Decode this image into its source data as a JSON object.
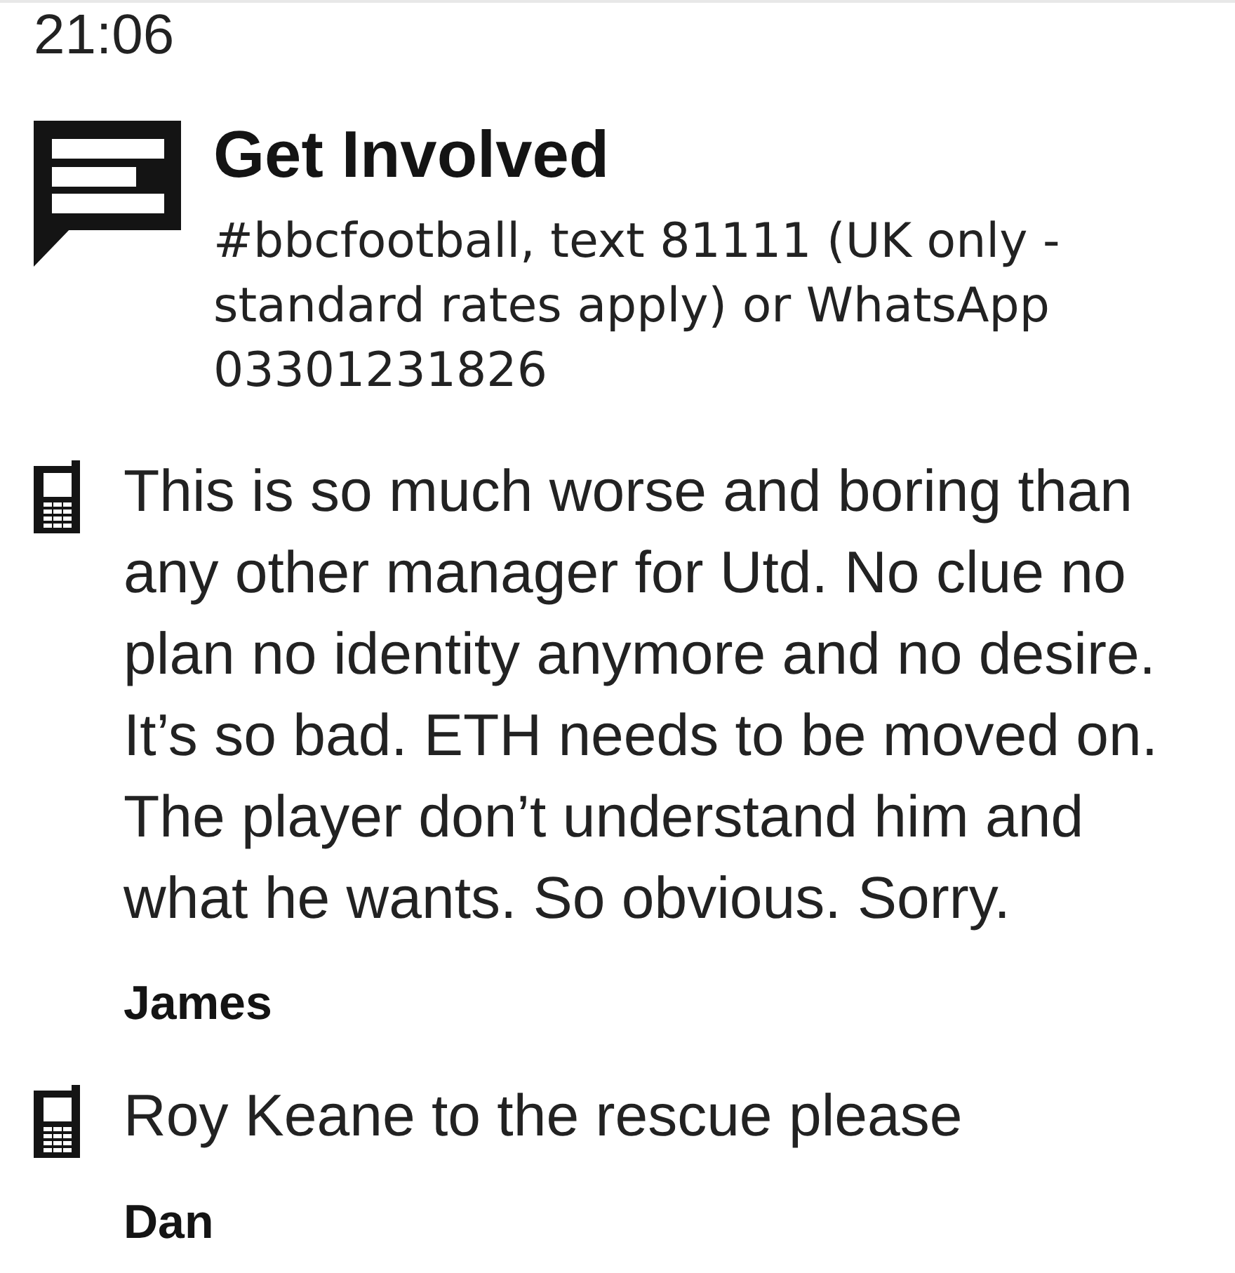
{
  "time": "21:06",
  "get_involved": {
    "title": "Get Involved",
    "text": "#bbcfootball, text 81111 (UK only - standard rates apply) or WhatsApp 03301231826"
  },
  "comments": [
    {
      "text": "This is so much worse and boring than any other manager for Utd. No clue no plan no identity anymore and no desire. It’s so bad. ETH needs to be moved on. The player don’t understand him and what he wants. So obvious. Sorry.",
      "author": "James"
    },
    {
      "text": "Roy Keane to the rescue please",
      "author": "Dan"
    }
  ]
}
